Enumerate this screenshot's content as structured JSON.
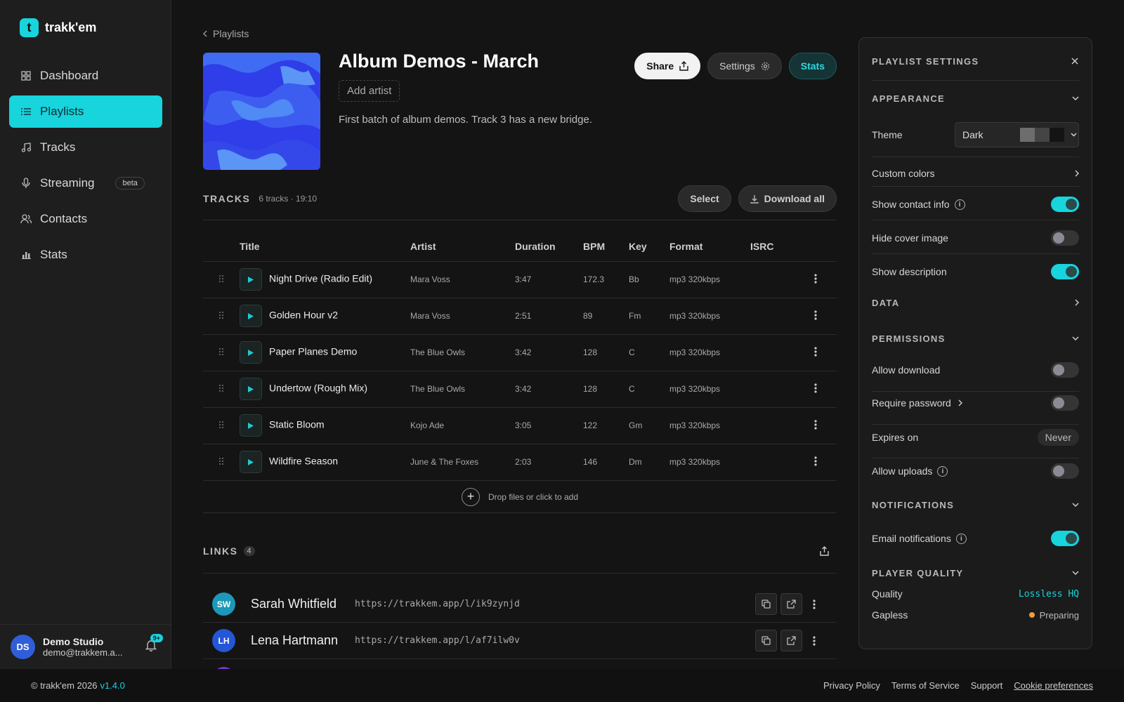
{
  "app": {
    "name": "trakk'em",
    "logo_letter": "t"
  },
  "sidebar": {
    "items": [
      {
        "label": "Dashboard",
        "icon": "grid-icon"
      },
      {
        "label": "Playlists",
        "icon": "list-icon",
        "active": true
      },
      {
        "label": "Tracks",
        "icon": "music-note-icon"
      },
      {
        "label": "Streaming",
        "icon": "microphone-icon",
        "badge": "beta"
      },
      {
        "label": "Contacts",
        "icon": "users-icon"
      },
      {
        "label": "Stats",
        "icon": "bar-chart-icon"
      }
    ],
    "user": {
      "initials": "DS",
      "name": "Demo Studio",
      "email": "demo@trakkem.a...",
      "notifications": "9+"
    }
  },
  "page": {
    "breadcrumb": "Playlists",
    "title": "Album Demos - March",
    "add_artist": "Add artist",
    "description": "First batch of album demos. Track 3 has a new bridge.",
    "actions": {
      "share": "Share",
      "settings": "Settings",
      "stats": "Stats"
    }
  },
  "tracks": {
    "heading": "TRACKS",
    "meta": "6 tracks · 19:10",
    "select": "Select",
    "download_all": "Download all",
    "columns": [
      "Title",
      "Artist",
      "Duration",
      "BPM",
      "Key",
      "Format",
      "ISRC"
    ],
    "rows": [
      {
        "title": "Night Drive (Radio Edit)",
        "artist": "Mara Voss",
        "duration": "3:47",
        "bpm": "172.3",
        "key": "Bb",
        "format": "mp3 320kbps",
        "isrc": ""
      },
      {
        "title": "Golden Hour v2",
        "artist": "Mara Voss",
        "duration": "2:51",
        "bpm": "89",
        "key": "Fm",
        "format": "mp3 320kbps",
        "isrc": ""
      },
      {
        "title": "Paper Planes Demo",
        "artist": "The Blue Owls",
        "duration": "3:42",
        "bpm": "128",
        "key": "C",
        "format": "mp3 320kbps",
        "isrc": ""
      },
      {
        "title": "Undertow (Rough Mix)",
        "artist": "The Blue Owls",
        "duration": "3:42",
        "bpm": "128",
        "key": "C",
        "format": "mp3 320kbps",
        "isrc": ""
      },
      {
        "title": "Static Bloom",
        "artist": "Kojo Ade",
        "duration": "3:05",
        "bpm": "122",
        "key": "Gm",
        "format": "mp3 320kbps",
        "isrc": ""
      },
      {
        "title": "Wildfire Season",
        "artist": "June & The Foxes",
        "duration": "2:03",
        "bpm": "146",
        "key": "Dm",
        "format": "mp3 320kbps",
        "isrc": ""
      }
    ],
    "drop_text": "Drop files or click to add"
  },
  "links": {
    "heading": "LINKS",
    "count": "4",
    "rows": [
      {
        "initials": "SW",
        "name": "Sarah Whitfield",
        "url": "https://trakkem.app/l/ik9zynjd",
        "color": "#1c98b8"
      },
      {
        "initials": "LH",
        "name": "Lena Hartmann",
        "url": "https://trakkem.app/l/af7ilw0v",
        "color": "#2456d6"
      }
    ]
  },
  "settings": {
    "title": "PLAYLIST SETTINGS",
    "appearance": "APPEARANCE",
    "theme_label": "Theme",
    "theme_value": "Dark",
    "custom_colors": "Custom colors",
    "show_contact": "Show contact info",
    "hide_cover": "Hide cover image",
    "show_description": "Show description",
    "data": "DATA",
    "permissions": "PERMISSIONS",
    "allow_download": "Allow download",
    "require_password": "Require password",
    "expires_on": "Expires on",
    "expires_value": "Never",
    "allow_uploads": "Allow uploads",
    "notifications": "NOTIFICATIONS",
    "email_notifications": "Email notifications",
    "player_quality": "PLAYER QUALITY",
    "quality_label": "Quality",
    "quality_value": "Lossless HQ",
    "gapless_label": "Gapless",
    "gapless_value": "Preparing",
    "toggles": {
      "show_contact": true,
      "hide_cover": false,
      "show_description": true,
      "allow_download": false,
      "require_password": false,
      "allow_uploads": false,
      "email_notifications": true
    }
  },
  "footer": {
    "copyright": "© trakk'em 2026",
    "version": "v1.4.0",
    "links": [
      "Privacy Policy",
      "Terms of Service",
      "Support",
      "Cookie preferences"
    ]
  },
  "colors": {
    "accent": "#17d4dd",
    "background": "#141414",
    "sidebar": "#1e1e1f"
  }
}
